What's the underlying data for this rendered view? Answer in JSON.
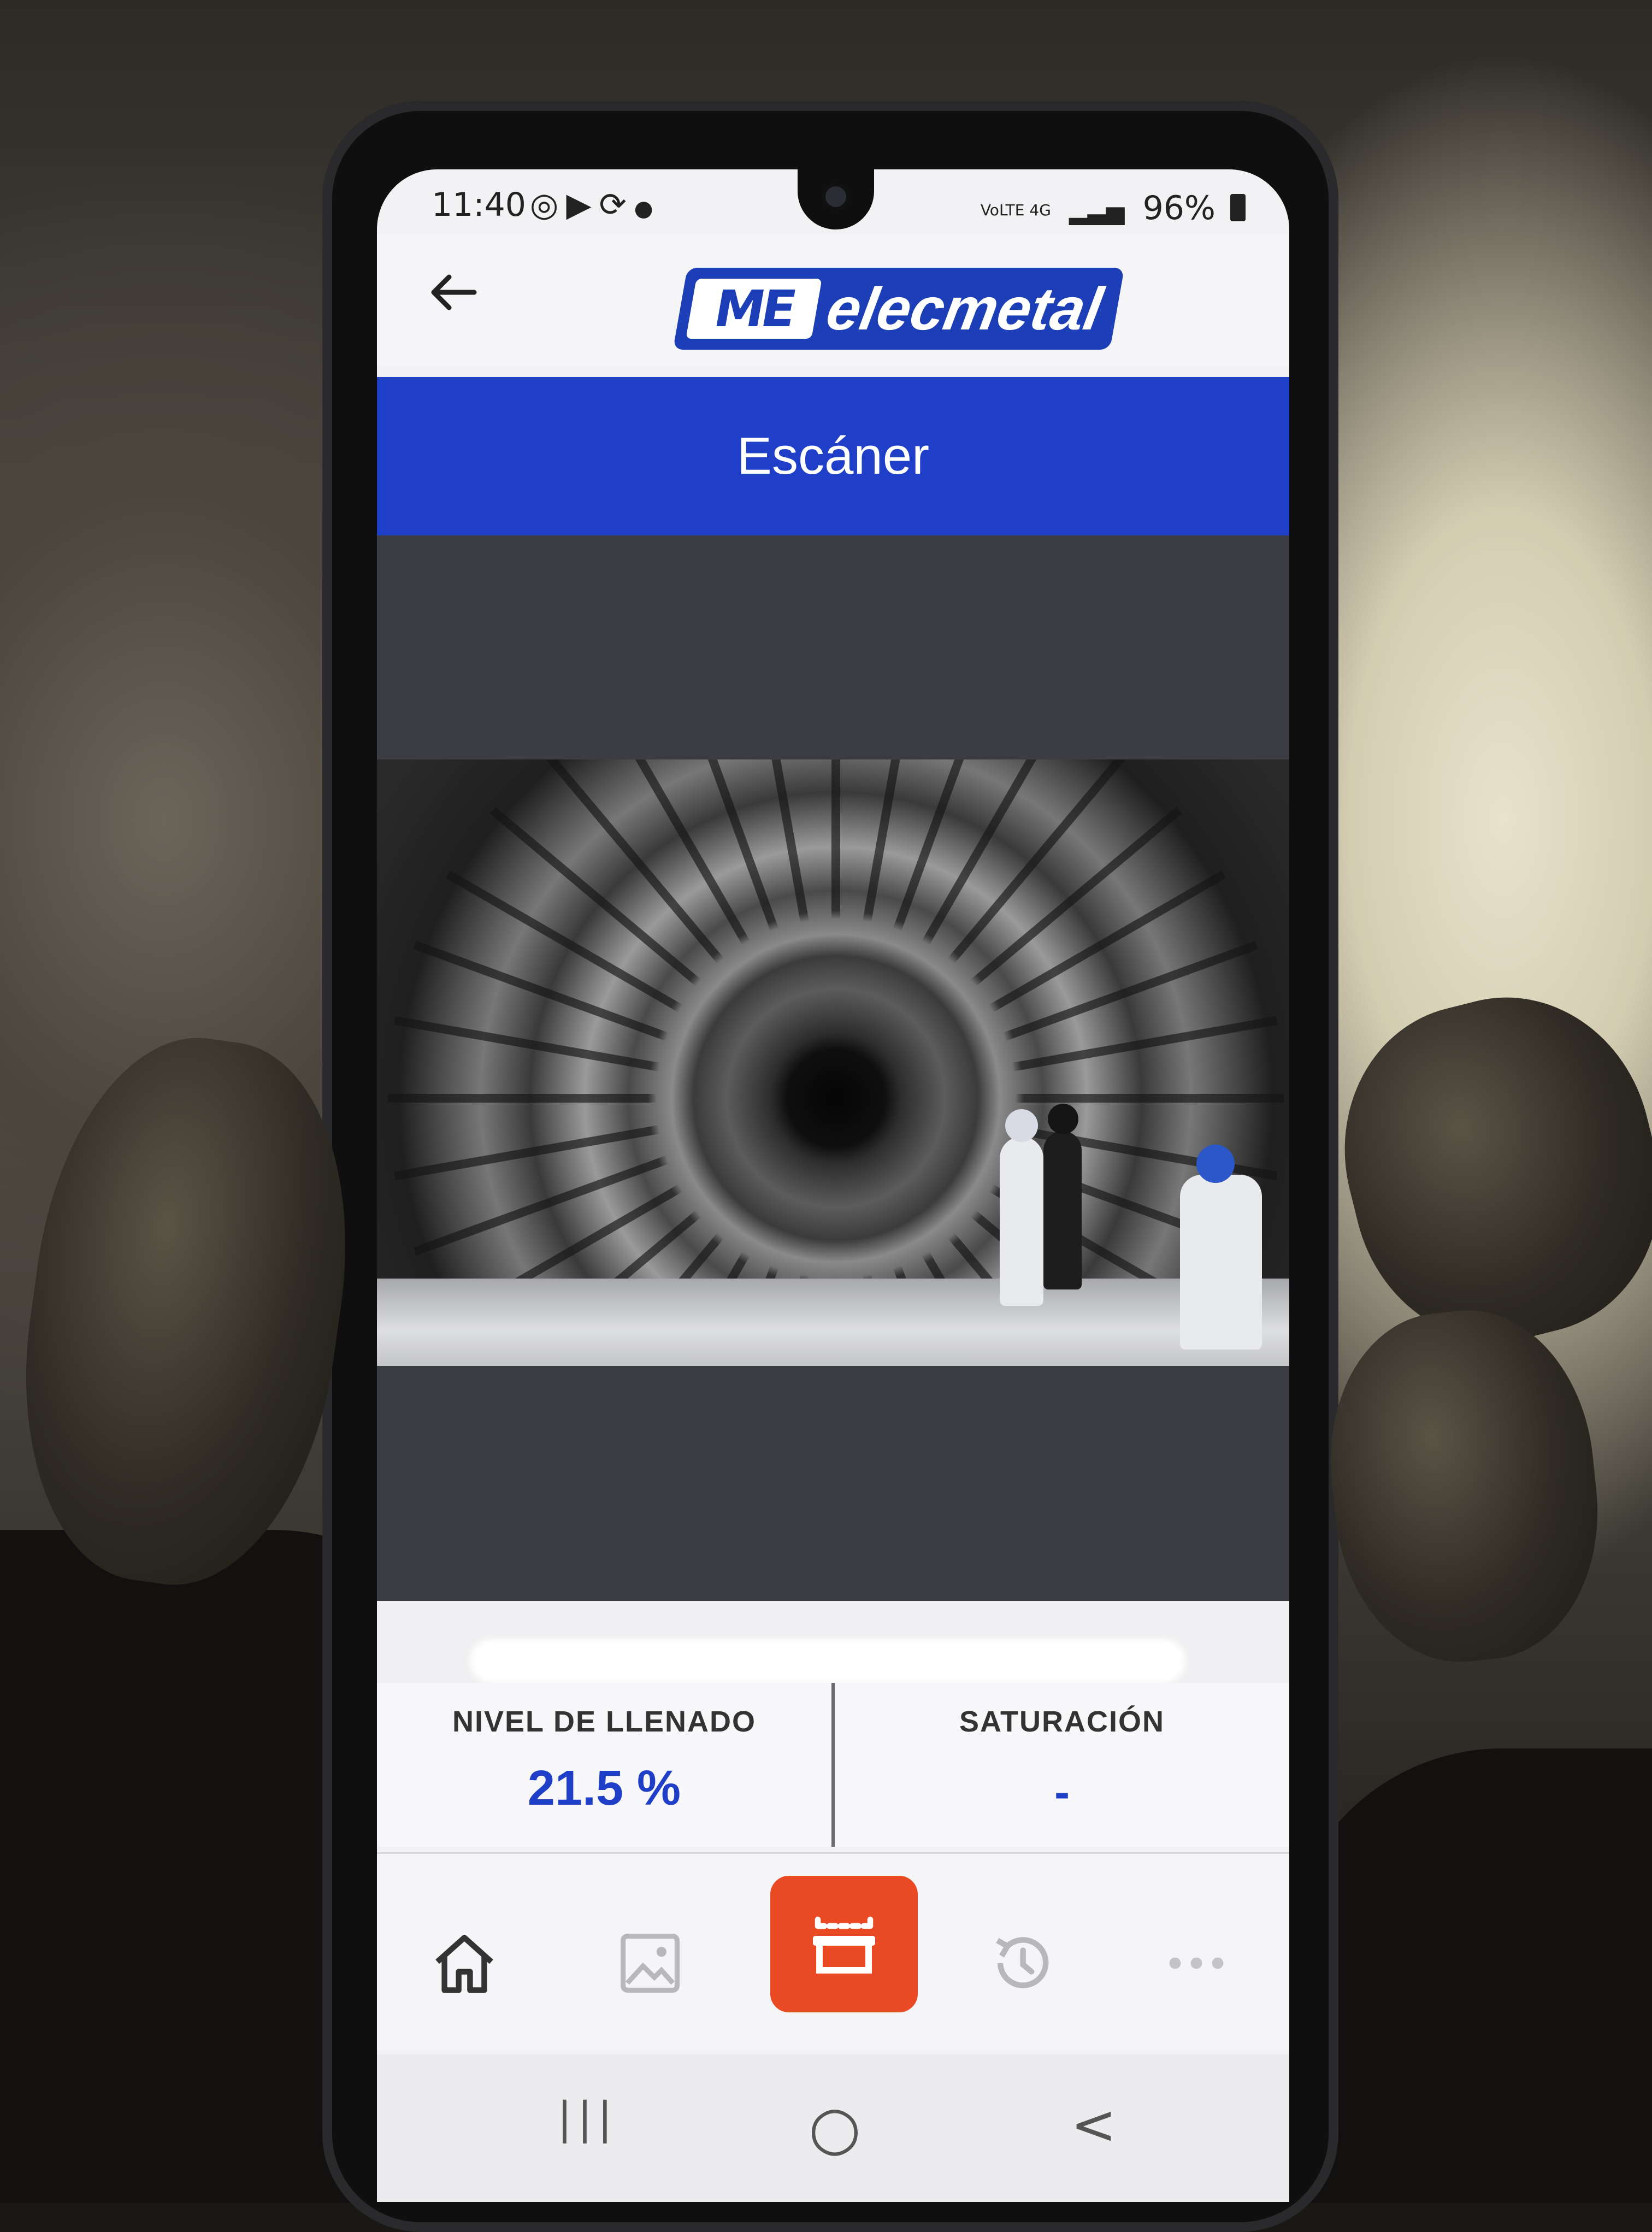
{
  "status_bar": {
    "time": "11:40",
    "notification_icons": [
      "whatsapp-icon",
      "youtube-icon",
      "sync-icon",
      "dot-icon"
    ],
    "network_label": "VoLTE 4G",
    "battery": "96%"
  },
  "app_bar": {
    "back_icon": "arrow-left-icon",
    "logo_mark": "ME",
    "logo_text": "elecmetal"
  },
  "page": {
    "title": "Escáner"
  },
  "metrics": {
    "fill_level_label": "NIVEL DE LLENADO",
    "fill_level_value": "21.5 %",
    "saturation_label": "SATURACIÓN",
    "saturation_value": "-"
  },
  "bottom_nav": {
    "items": [
      "home-icon",
      "gallery-icon",
      "scanner-icon",
      "history-icon",
      "more-icon"
    ],
    "active": "scanner-icon",
    "accent": "#ea4a23"
  },
  "system_nav": {
    "recents": "|||",
    "home": "○",
    "back": "<"
  },
  "colors": {
    "brand_blue": "#1f3fc8",
    "scanner_accent": "#ea4a23"
  }
}
